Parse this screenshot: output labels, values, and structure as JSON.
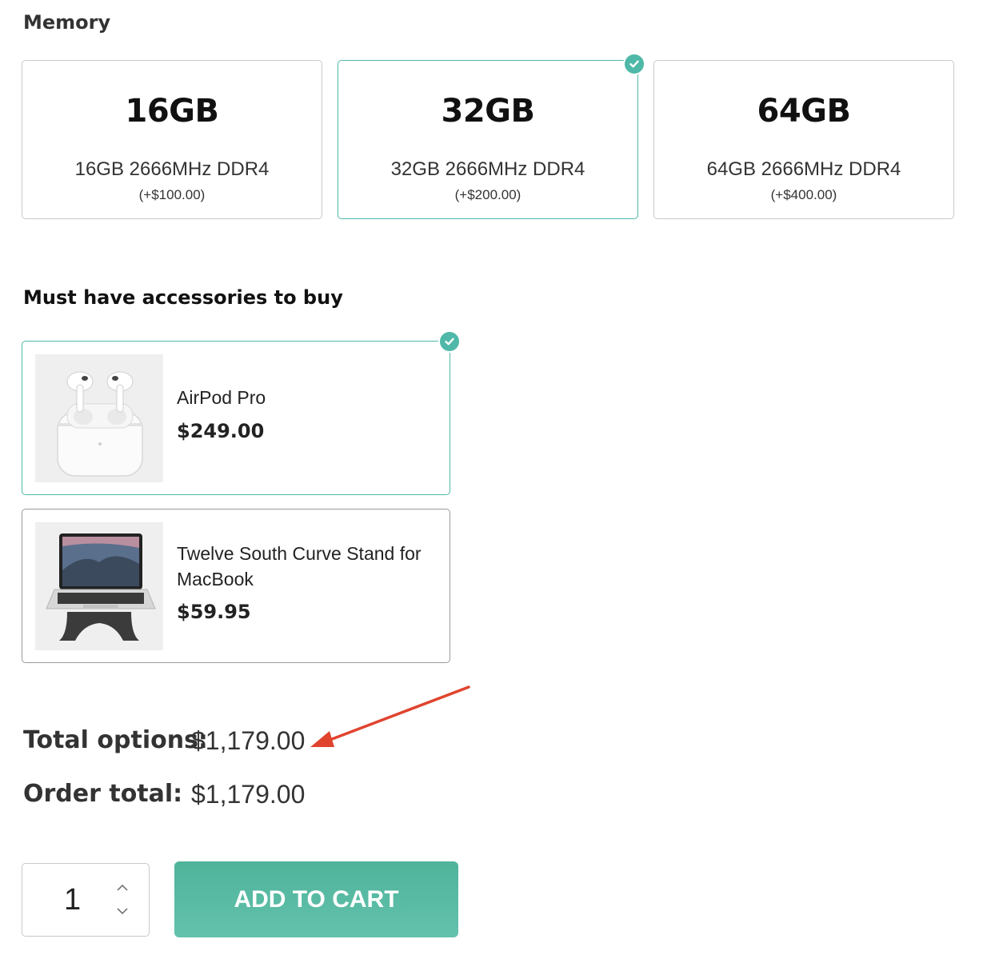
{
  "memory": {
    "title": "Memory",
    "options": [
      {
        "size": "16GB",
        "description": "16GB 2666MHz DDR4",
        "price": "(+$100.00)",
        "selected": false
      },
      {
        "size": "32GB",
        "description": "32GB 2666MHz DDR4",
        "price": "(+$200.00)",
        "selected": true
      },
      {
        "size": "64GB",
        "description": "64GB 2666MHz DDR4",
        "price": "(+$400.00)",
        "selected": false
      }
    ]
  },
  "accessories": {
    "title": "Must have accessories to buy",
    "items": [
      {
        "name": "AirPod Pro",
        "price": "$249.00",
        "selected": true,
        "image": "airpods-image"
      },
      {
        "name": "Twelve South Curve Stand for MacBook",
        "price": "$59.95",
        "selected": false,
        "image": "macbook-stand-image"
      }
    ]
  },
  "totals": {
    "options_label": "Total options:",
    "options_value": "$1,179.00",
    "order_label": "Order total:",
    "order_value": "$1,179.00"
  },
  "cart": {
    "quantity": "1",
    "button_label": "ADD TO CART"
  },
  "colors": {
    "accent": "#4fb8a8",
    "button": "#57b9a1",
    "annotation_arrow": "#e0442f"
  }
}
